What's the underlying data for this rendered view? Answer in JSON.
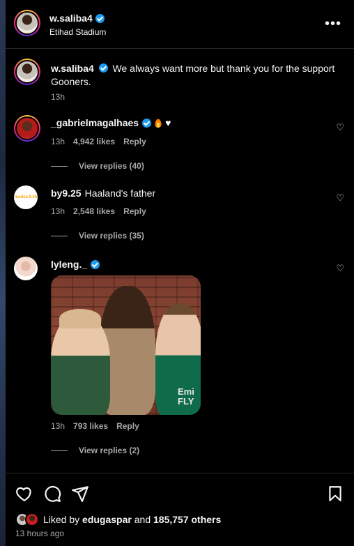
{
  "post": {
    "author": "w.saliba4",
    "location": "Etihad Stadium",
    "more_label": "•••"
  },
  "caption": {
    "username": "w.saliba4",
    "text": "We always want more but thank you for the support Gooners.",
    "time": "13h"
  },
  "comments": [
    {
      "username": "_gabrielmagalhaes",
      "text": "",
      "time": "13h",
      "likes": "4,942 likes",
      "reply_label": "Reply",
      "view_replies": "View replies (40)"
    },
    {
      "username": "by9.25",
      "text": "Haaland's father",
      "time": "13h",
      "likes": "2,548 likes",
      "reply_label": "Reply",
      "view_replies": "View replies (35)",
      "avatar_text_a": "madsa",
      "avatar_text_b": "9.25"
    },
    {
      "username": "lyleng._",
      "text": "",
      "time": "13h",
      "likes": "793 likes",
      "reply_label": "Reply",
      "view_replies": "View replies (2)",
      "image_jersey_text": "Emi FLY"
    }
  ],
  "engagement": {
    "liked_prefix": "Liked by",
    "liked_user": "edugaspar",
    "liked_and": "and",
    "liked_count": "185,757 others",
    "post_time": "13 hours ago"
  },
  "colors": {
    "verified": "#1d9bf0",
    "secondary_text": "#a8a8a8",
    "background": "#000000"
  }
}
